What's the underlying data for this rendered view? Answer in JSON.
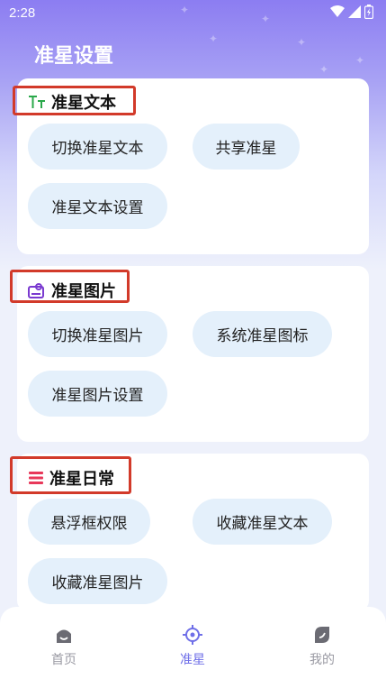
{
  "status": {
    "time": "2:28",
    "icons": [
      "wifi-icon",
      "signal-icon",
      "battery-icon"
    ]
  },
  "header": {
    "title": "准星设置"
  },
  "sections": [
    {
      "title": "准星文本",
      "icon": "text-format-icon",
      "icon_color": "#2aa84a",
      "chips": [
        "切换准星文本",
        "共享准星",
        "准星文本设置"
      ]
    },
    {
      "title": "准星图片",
      "icon": "image-card-icon",
      "icon_color": "#7a3ad0",
      "chips": [
        "切换准星图片",
        "系统准星图标",
        "准星图片设置"
      ]
    },
    {
      "title": "准星日常",
      "icon": "list-icon",
      "icon_color": "#e8385a",
      "chips": [
        "悬浮框权限",
        "收藏准星文本",
        "收藏准星图片"
      ]
    }
  ],
  "nav": {
    "items": [
      {
        "label": "首页",
        "icon": "home-icon",
        "active": false
      },
      {
        "label": "准星",
        "icon": "crosshair-icon",
        "active": true
      },
      {
        "label": "我的",
        "icon": "profile-icon",
        "active": false
      }
    ],
    "active_color": "#6f6fe8",
    "inactive_color": "#9a9aa3"
  },
  "colors": {
    "accent": "#8c7df2",
    "chip_bg": "#e4f0fb",
    "highlight_border": "#d23a2a"
  }
}
